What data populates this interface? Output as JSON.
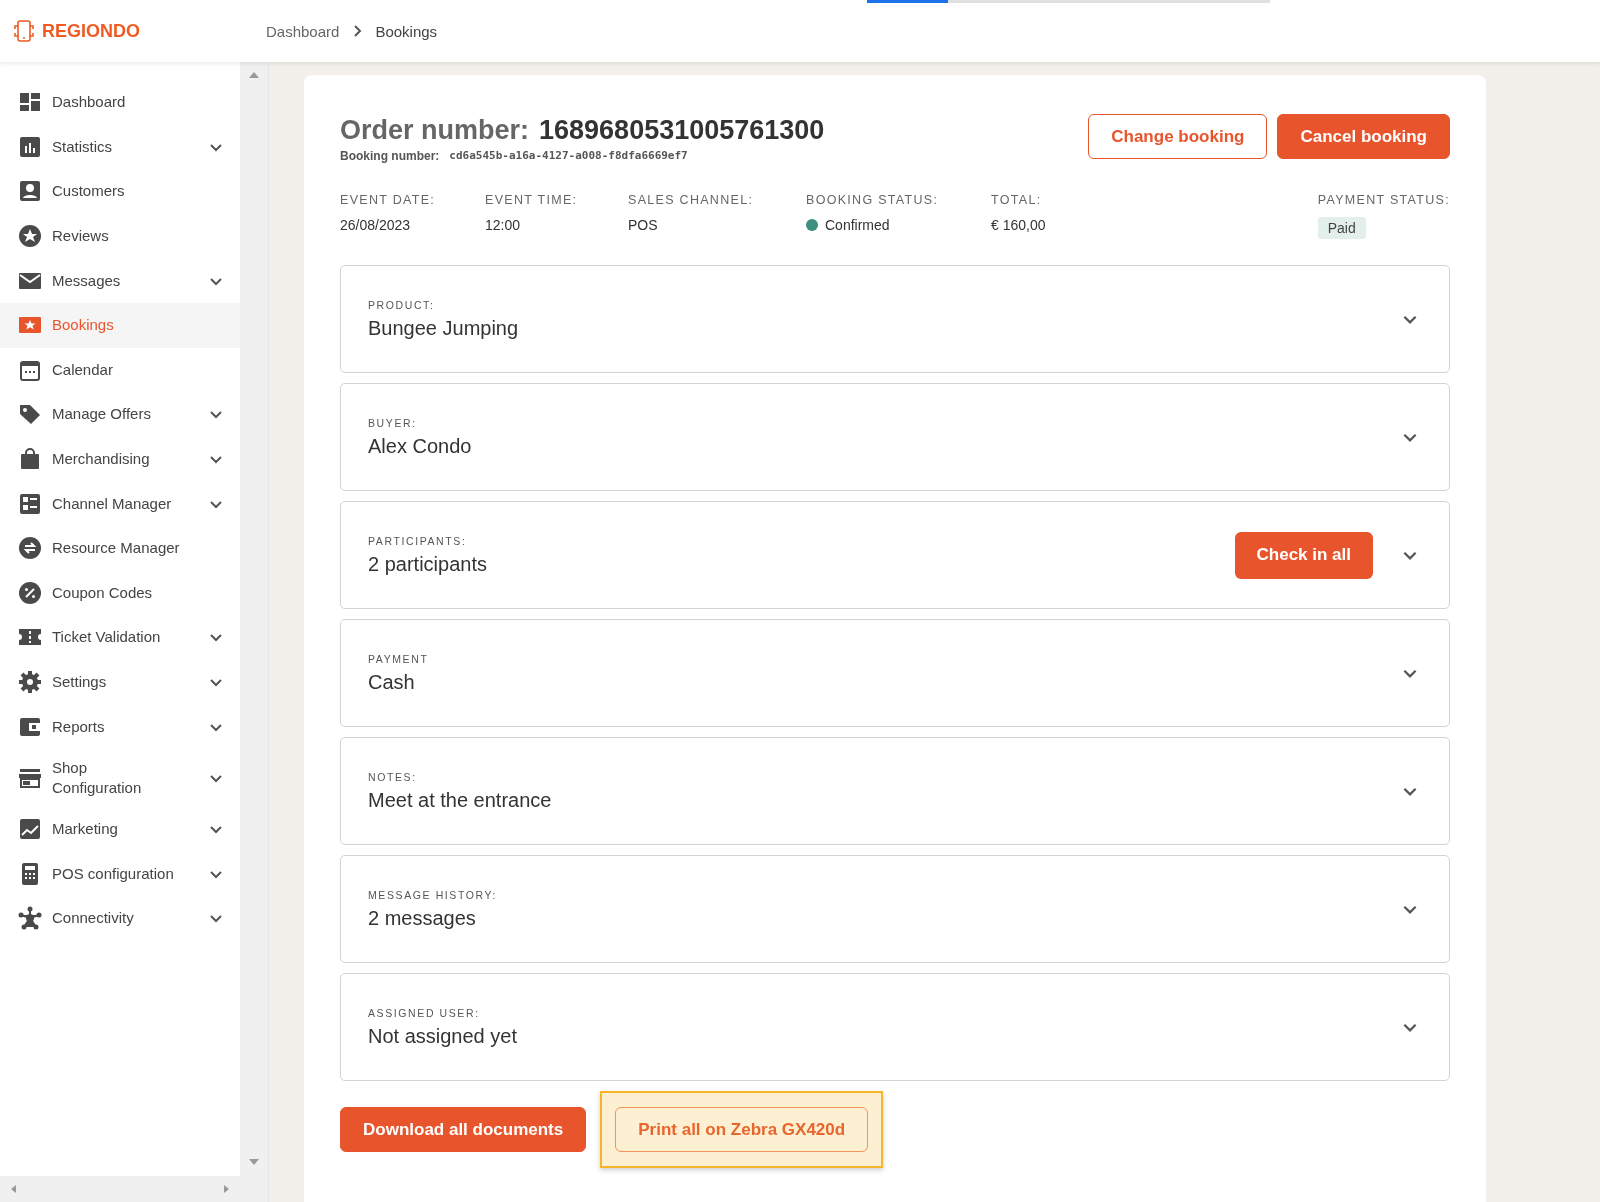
{
  "header": {
    "logo": "REGIONDO",
    "breadcrumb": [
      "Dashboard",
      "Bookings"
    ],
    "loading_bar": {
      "level": 0.2
    }
  },
  "sidebar": {
    "items": [
      {
        "label": "Dashboard",
        "selected": false,
        "expandable": false
      },
      {
        "label": "Statistics",
        "selected": false,
        "expandable": true
      },
      {
        "label": "Customers",
        "selected": false,
        "expandable": false
      },
      {
        "label": "Reviews",
        "selected": false,
        "expandable": false
      },
      {
        "label": "Messages",
        "selected": false,
        "expandable": true
      },
      {
        "label": "Bookings",
        "selected": true,
        "expandable": false
      },
      {
        "label": "Calendar",
        "selected": false,
        "expandable": false
      },
      {
        "label": "Manage Offers",
        "selected": false,
        "expandable": true
      },
      {
        "label": "Merchandising",
        "selected": false,
        "expandable": true
      },
      {
        "label": "Channel Manager",
        "selected": false,
        "expandable": true
      },
      {
        "label": "Resource Manager",
        "selected": false,
        "expandable": false
      },
      {
        "label": "Coupon Codes",
        "selected": false,
        "expandable": false
      },
      {
        "label": "Ticket Validation",
        "selected": false,
        "expandable": true
      },
      {
        "label": "Settings",
        "selected": false,
        "expandable": true
      },
      {
        "label": "Reports",
        "selected": false,
        "expandable": true
      },
      {
        "label": "Shop Configuration",
        "selected": false,
        "expandable": true
      },
      {
        "label": "Marketing",
        "selected": false,
        "expandable": true
      },
      {
        "label": "POS configuration",
        "selected": false,
        "expandable": true
      },
      {
        "label": "Connectivity",
        "selected": false,
        "expandable": true
      }
    ]
  },
  "order": {
    "title_label": "Order number:",
    "number": "1689680531005761300",
    "booking_label": "Booking number:",
    "booking_number": "cd6a545b-a16a-4127-a008-f8dfa6669ef7",
    "buttons": [
      {
        "label": "Change booking",
        "kind": "outline"
      },
      {
        "label": "Cancel booking",
        "kind": "filled"
      }
    ],
    "facts": [
      {
        "label": "EVENT DATE:",
        "value": "26/08/2023",
        "kind": "text"
      },
      {
        "label": "EVENT TIME:",
        "value": "12:00",
        "kind": "text"
      },
      {
        "label": "SALES CHANNEL:",
        "value": "POS",
        "kind": "text"
      },
      {
        "label": "BOOKING STATUS:",
        "value": "Confirmed",
        "kind": "status",
        "color": "#3d8f7f"
      },
      {
        "label": "TOTAL:",
        "value": "€ 160,00",
        "kind": "text"
      },
      {
        "label": "PAYMENT STATUS:",
        "value": "Paid",
        "kind": "badge"
      }
    ],
    "panels": [
      {
        "label": "PRODUCT:",
        "value": "Bungee Jumping",
        "expanded": false
      },
      {
        "label": "BUYER:",
        "value": "Alex Condo",
        "expanded": false
      },
      {
        "label": "PARTICIPANTS:",
        "value": "2 participants",
        "expanded": false,
        "action": "Check in all"
      },
      {
        "label": "PAYMENT",
        "value": "Cash",
        "expanded": false
      },
      {
        "label": "NOTES:",
        "value": "Meet at the entrance",
        "expanded": false
      },
      {
        "label": "MESSAGE HISTORY:",
        "value": "2 messages",
        "expanded": false
      },
      {
        "label": "ASSIGNED USER:",
        "value": "Not assigned yet",
        "expanded": false
      }
    ],
    "footer_buttons": [
      {
        "label": "Download all documents",
        "kind": "filled",
        "highlighted": false
      },
      {
        "label": "Print all on Zebra GX420d",
        "kind": "outline",
        "highlighted": true
      }
    ]
  }
}
